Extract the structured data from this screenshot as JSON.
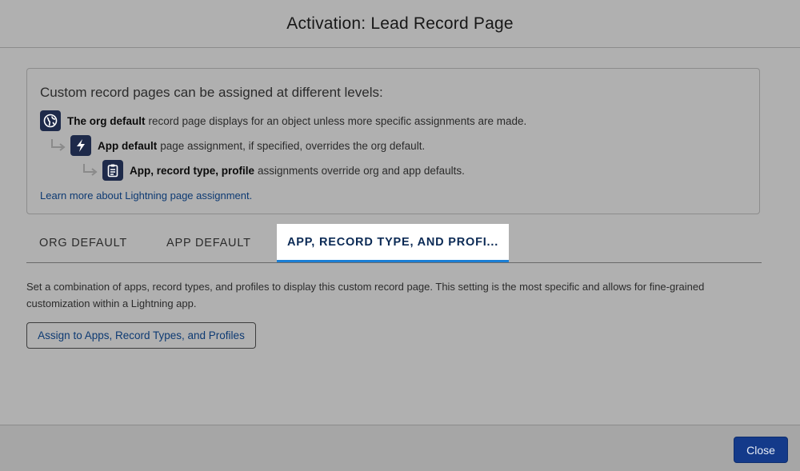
{
  "modal": {
    "title": "Activation: Lead Record Page"
  },
  "info": {
    "heading": "Custom record pages can be assigned at different levels:",
    "levels": [
      {
        "icon": "globe-icon",
        "bold": "The org default",
        "text": "record page displays for an object unless more specific assignments are made."
      },
      {
        "icon": "lightning-bolt-icon",
        "bold": "App default",
        "text": "page assignment, if specified, overrides the org default."
      },
      {
        "icon": "clipboard-icon",
        "bold": "App, record type, profile",
        "text": "assignments override org and app defaults."
      }
    ],
    "learn_more": "Learn more about Lightning page assignment."
  },
  "tabs": [
    {
      "label": "ORG DEFAULT",
      "active": false
    },
    {
      "label": "APP DEFAULT",
      "active": false
    },
    {
      "label": "APP, RECORD TYPE, AND PROFI...",
      "active": true
    }
  ],
  "content": {
    "description": "Set a combination of apps, record types, and profiles to display this custom record page. This setting is the most specific and allows for fine-grained customization within a Lightning app.",
    "assign_button": "Assign to Apps, Record Types, and Profiles"
  },
  "footer": {
    "close_label": "Close"
  },
  "colors": {
    "overlay": "#b0b0b0",
    "badge": "#1e2a4a",
    "link": "#0d3a73",
    "active_tab_underline": "#1b7fd6",
    "brand_button": "#143a8a"
  }
}
